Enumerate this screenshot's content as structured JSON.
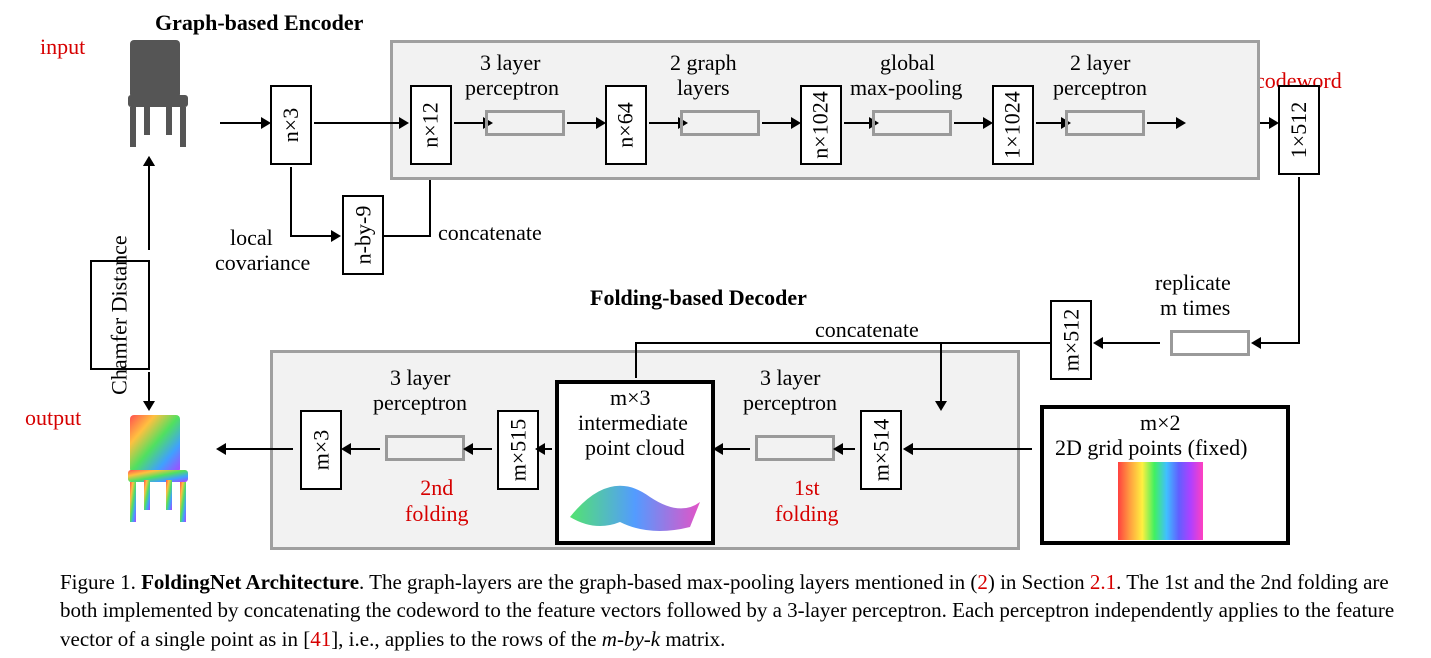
{
  "titles": {
    "encoder": "Graph-based Encoder",
    "decoder": "Folding-based Decoder"
  },
  "redlabels": {
    "input": "input",
    "output": "output",
    "codeword": "codeword",
    "first_folding": "1st\nfolding",
    "second_folding": "2nd\nfolding"
  },
  "labels": {
    "local_cov1": "local",
    "local_cov2": "covariance",
    "concat1": "concatenate",
    "concat2": "concatenate",
    "p3a": "3 layer",
    "p3b": "perceptron",
    "g2a": "2 graph",
    "g2b": "layers",
    "gma": "global",
    "gmb": "max-pooling",
    "p2a": "2 layer",
    "p2b": "perceptron",
    "repa": "replicate",
    "repb": "m times",
    "d3a": "3 layer",
    "d3b": "perceptron",
    "d3a2": "3 layer",
    "d3b2": "perceptron",
    "mx3i": "m×3",
    "interm1": "intermediate",
    "interm2": "point cloud",
    "grid1": "m×2",
    "grid2": "2D grid points (fixed)"
  },
  "dims": {
    "nx3": "n×3",
    "nby9": "n-by-9",
    "nx12": "n×12",
    "nx64": "n×64",
    "nx1024": "n×1024",
    "1x1024": "1×1024",
    "1x512": "1×512",
    "mx512": "m×512",
    "mx514": "m×514",
    "mx515": "m×515",
    "mx3": "m×3",
    "chamfer": "Chamfer\nDistance"
  },
  "caption": {
    "fig": "Figure 1. ",
    "title": "FoldingNet Architecture",
    "body1": ". The graph-layers are the graph-based max-pooling layers mentioned in (",
    "l1": "2",
    "body2": ") in Section ",
    "l2": "2.1",
    "body3": ". The 1st and the 2nd folding are both implemented by concatenating the codeword to the feature vectors followed by a 3-layer perceptron. Each perceptron independently applies to the feature vector of a single point as in [",
    "l3": "41",
    "body4": "], i.e., applies to the rows of the ",
    "mk": "m-by-k",
    "body5": " matrix."
  }
}
